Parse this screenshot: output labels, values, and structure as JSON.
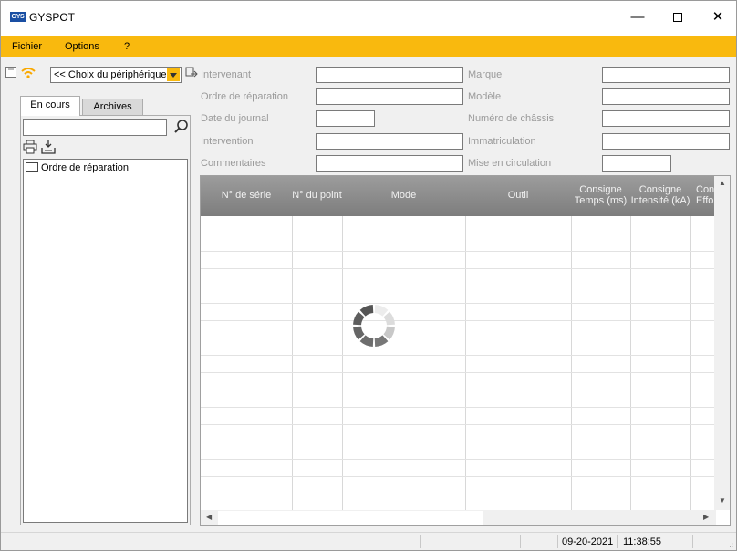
{
  "window": {
    "title": "GYSPOT",
    "logo_text": "GYS"
  },
  "menu": {
    "items": [
      "Fichier",
      "Options",
      "?"
    ]
  },
  "toolbar": {
    "device_select": "<< Choix du périphérique"
  },
  "tabs": [
    {
      "label": "En cours",
      "active": true
    },
    {
      "label": "Archives",
      "active": false
    }
  ],
  "search": {
    "value": "",
    "placeholder": ""
  },
  "tree": {
    "items": [
      "Ordre de réparation"
    ]
  },
  "form": {
    "left": [
      {
        "label": "Intervenant",
        "value": ""
      },
      {
        "label": "Ordre de réparation",
        "value": ""
      },
      {
        "label": "Date du journal",
        "value": ""
      },
      {
        "label": "Intervention",
        "value": ""
      },
      {
        "label": "Commentaires",
        "value": ""
      }
    ],
    "right": [
      {
        "label": "Marque",
        "value": ""
      },
      {
        "label": "Modèle",
        "value": ""
      },
      {
        "label": "Numéro de châssis",
        "value": ""
      },
      {
        "label": "Immatriculation",
        "value": ""
      },
      {
        "label": "Mise en circulation",
        "value": ""
      }
    ]
  },
  "grid": {
    "columns": [
      [
        "N° de série"
      ],
      [
        "N° du point"
      ],
      [
        "Mode"
      ],
      [
        "Outil"
      ],
      [
        "Consigne",
        "Temps (ms)"
      ],
      [
        "Consigne",
        "Intensité (kA)"
      ],
      [
        "Con",
        "Effor"
      ]
    ],
    "rows": []
  },
  "status": {
    "date": "09-20-2021",
    "time": "11:38:55"
  },
  "colors": {
    "menubar": "#f9b90e",
    "grid_header": "#8c8c8c",
    "accent": "#f9b90e"
  }
}
